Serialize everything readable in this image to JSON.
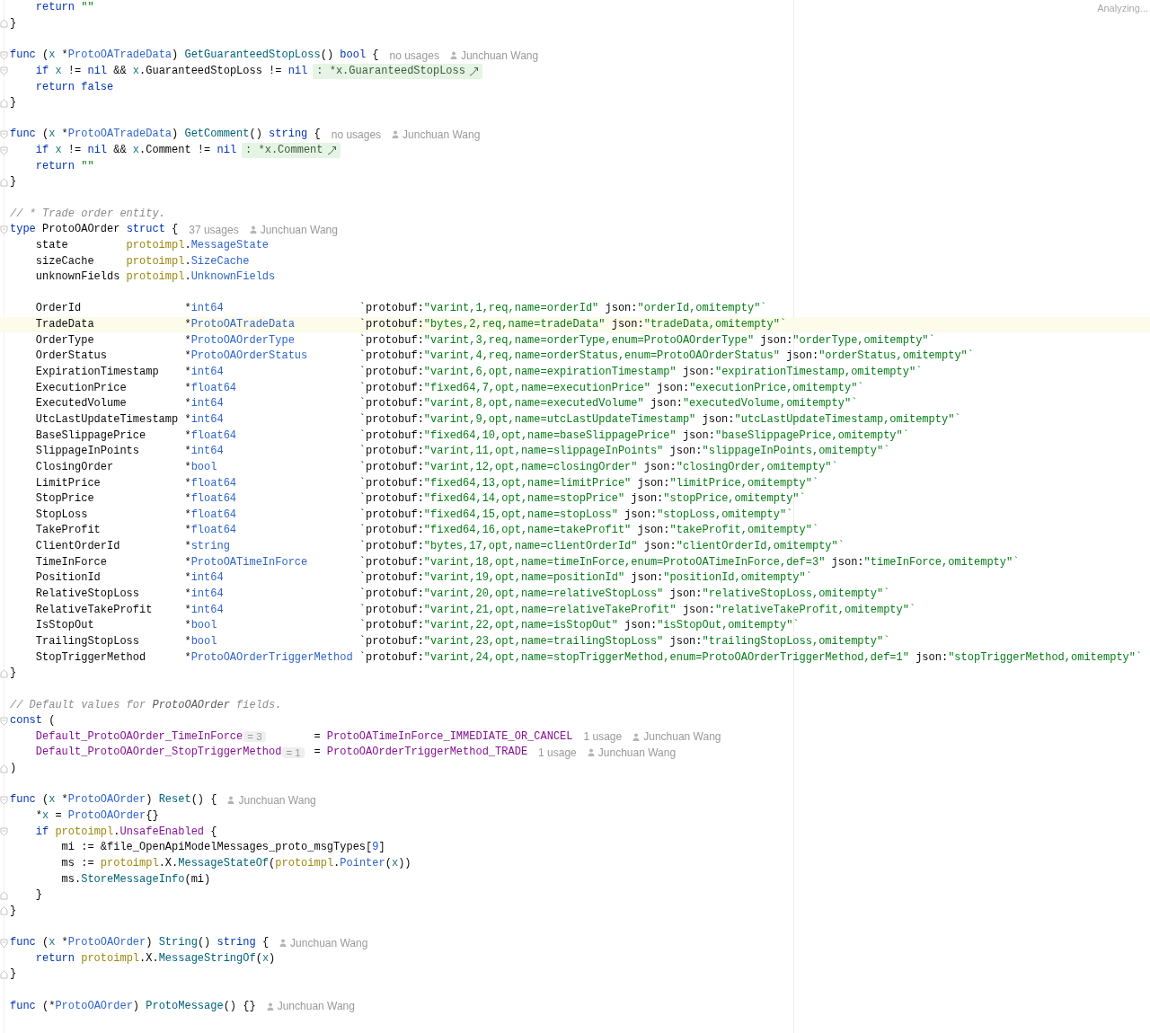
{
  "status": "Analyzing...",
  "lines": [
    {
      "kind": "code",
      "highlighted": false,
      "tokens": [
        {
          "kind": "kw",
          "text": "    return "
        },
        {
          "kind": "str",
          "text": "\"\""
        }
      ]
    },
    {
      "kind": "code",
      "highlighted": false,
      "gutter": {
        "kind": "fold_end"
      },
      "tokens": [
        {
          "kind": "plain",
          "text": "}"
        }
      ]
    },
    {
      "kind": "blank",
      "highlighted": false
    },
    {
      "kind": "code",
      "highlighted": false,
      "gutter": {
        "kind": "fold_start"
      },
      "tokens": [
        {
          "kind": "kw",
          "text": "func"
        },
        {
          "kind": "plain",
          "text": " ("
        },
        {
          "kind": "recv",
          "text": "x"
        },
        {
          "kind": "plain",
          "text": " *"
        },
        {
          "kind": "type",
          "text": "ProtoOATradeData"
        },
        {
          "kind": "plain",
          "text": ") "
        },
        {
          "kind": "fn",
          "text": "GetGuaranteedStopLoss"
        },
        {
          "kind": "plain",
          "text": "() "
        },
        {
          "kind": "kw",
          "text": "bool"
        },
        {
          "kind": "plain",
          "text": " {"
        }
      ],
      "usages": "no usages",
      "author": "Junchuan Wang"
    },
    {
      "kind": "code",
      "highlighted": false,
      "gutter": {
        "kind": "fold_start"
      },
      "tokens": [
        {
          "kind": "kw",
          "text": "    if "
        },
        {
          "kind": "recv",
          "text": "x"
        },
        {
          "kind": "plain",
          "text": " != "
        },
        {
          "kind": "kw",
          "text": "nil"
        },
        {
          "kind": "plain",
          "text": " && "
        },
        {
          "kind": "recv",
          "text": "x"
        },
        {
          "kind": "plain",
          "text": ".GuaranteedStopLoss != "
        },
        {
          "kind": "kw",
          "text": "nil"
        }
      ],
      "inlay": ": *x.GuaranteedStopLoss"
    },
    {
      "kind": "code",
      "highlighted": false,
      "tokens": [
        {
          "kind": "kw",
          "text": "    return false"
        }
      ]
    },
    {
      "kind": "code",
      "highlighted": false,
      "gutter": {
        "kind": "fold_end"
      },
      "tokens": [
        {
          "kind": "plain",
          "text": "}"
        }
      ]
    },
    {
      "kind": "blank",
      "highlighted": false
    },
    {
      "kind": "code",
      "highlighted": false,
      "gutter": {
        "kind": "fold_start"
      },
      "tokens": [
        {
          "kind": "kw",
          "text": "func"
        },
        {
          "kind": "plain",
          "text": " ("
        },
        {
          "kind": "recv",
          "text": "x"
        },
        {
          "kind": "plain",
          "text": " *"
        },
        {
          "kind": "type",
          "text": "ProtoOATradeData"
        },
        {
          "kind": "plain",
          "text": ") "
        },
        {
          "kind": "fn",
          "text": "GetComment"
        },
        {
          "kind": "plain",
          "text": "() "
        },
        {
          "kind": "kw",
          "text": "string"
        },
        {
          "kind": "plain",
          "text": " {"
        }
      ],
      "usages": "no usages",
      "author": "Junchuan Wang"
    },
    {
      "kind": "code",
      "highlighted": false,
      "gutter": {
        "kind": "fold_start"
      },
      "tokens": [
        {
          "kind": "kw",
          "text": "    if "
        },
        {
          "kind": "recv",
          "text": "x"
        },
        {
          "kind": "plain",
          "text": " != "
        },
        {
          "kind": "kw",
          "text": "nil"
        },
        {
          "kind": "plain",
          "text": " && "
        },
        {
          "kind": "recv",
          "text": "x"
        },
        {
          "kind": "plain",
          "text": ".Comment != "
        },
        {
          "kind": "kw",
          "text": "nil"
        }
      ],
      "inlay": ": *x.Comment"
    },
    {
      "kind": "code",
      "highlighted": false,
      "tokens": [
        {
          "kind": "kw",
          "text": "    return "
        },
        {
          "kind": "str",
          "text": "\"\""
        }
      ]
    },
    {
      "kind": "code",
      "highlighted": false,
      "gutter": {
        "kind": "fold_end"
      },
      "tokens": [
        {
          "kind": "plain",
          "text": "}"
        }
      ]
    },
    {
      "kind": "blank",
      "highlighted": false
    },
    {
      "kind": "code",
      "highlighted": false,
      "tokens": [
        {
          "kind": "cmt",
          "text": "// * Trade order entity."
        }
      ]
    },
    {
      "kind": "code",
      "highlighted": false,
      "gutter": {
        "kind": "fold_start"
      },
      "tokens": [
        {
          "kind": "kw",
          "text": "type"
        },
        {
          "kind": "plain",
          "text": " ProtoOAOrder "
        },
        {
          "kind": "kw",
          "text": "struct"
        },
        {
          "kind": "plain",
          "text": " {"
        }
      ],
      "usages": "37 usages",
      "author": "Junchuan Wang"
    },
    {
      "kind": "member",
      "highlighted": false,
      "name": "state",
      "type": [
        {
          "kind": "pkg",
          "text": "protoimpl"
        },
        {
          "kind": "plain",
          "text": "."
        },
        {
          "kind": "type",
          "text": "MessageState"
        }
      ]
    },
    {
      "kind": "member",
      "highlighted": false,
      "name": "sizeCache",
      "type": [
        {
          "kind": "pkg",
          "text": "protoimpl"
        },
        {
          "kind": "plain",
          "text": "."
        },
        {
          "kind": "type",
          "text": "SizeCache"
        }
      ]
    },
    {
      "kind": "member",
      "highlighted": false,
      "name": "unknownFields",
      "type": [
        {
          "kind": "pkg",
          "text": "protoimpl"
        },
        {
          "kind": "plain",
          "text": "."
        },
        {
          "kind": "type",
          "text": "UnknownFields"
        }
      ]
    },
    {
      "kind": "blank",
      "highlighted": false
    },
    {
      "kind": "field",
      "highlighted": false,
      "name": "OrderId",
      "type": [
        {
          "kind": "plain",
          "text": "*"
        },
        {
          "kind": "type",
          "text": "int64"
        }
      ],
      "tag": [
        {
          "kind": "plain",
          "text": "`protobuf:"
        },
        {
          "kind": "str",
          "text": "\"varint,1,req,name=orderId\""
        },
        {
          "kind": "plain",
          "text": " json:"
        },
        {
          "kind": "str",
          "text": "\"orderId,omitempty\"`"
        }
      ]
    },
    {
      "kind": "field",
      "highlighted": true,
      "name": "TradeData",
      "type": [
        {
          "kind": "plain",
          "text": "*"
        },
        {
          "kind": "type",
          "text": "ProtoOATradeData"
        }
      ],
      "tag": [
        {
          "kind": "plain",
          "text": "`protobuf:"
        },
        {
          "kind": "str",
          "text": "\"bytes,2,req,name=tradeData\""
        },
        {
          "kind": "plain",
          "text": " json:"
        },
        {
          "kind": "str",
          "text": "\"tradeData,omitempty\"`"
        }
      ]
    },
    {
      "kind": "field",
      "highlighted": false,
      "name": "OrderType",
      "type": [
        {
          "kind": "plain",
          "text": "*"
        },
        {
          "kind": "type",
          "text": "ProtoOAOrderType"
        }
      ],
      "tag": [
        {
          "kind": "plain",
          "text": "`protobuf:"
        },
        {
          "kind": "str",
          "text": "\"varint,3,req,name=orderType,enum=ProtoOAOrderType\""
        },
        {
          "kind": "plain",
          "text": " json:"
        },
        {
          "kind": "str",
          "text": "\"orderType,omitempty\"`"
        }
      ]
    },
    {
      "kind": "field",
      "highlighted": false,
      "name": "OrderStatus",
      "type": [
        {
          "kind": "plain",
          "text": "*"
        },
        {
          "kind": "type",
          "text": "ProtoOAOrderStatus"
        }
      ],
      "tag": [
        {
          "kind": "plain",
          "text": "`protobuf:"
        },
        {
          "kind": "str",
          "text": "\"varint,4,req,name=orderStatus,enum=ProtoOAOrderStatus\""
        },
        {
          "kind": "plain",
          "text": " json:"
        },
        {
          "kind": "str",
          "text": "\"orderStatus,omitempty\"`"
        }
      ]
    },
    {
      "kind": "field",
      "highlighted": false,
      "name": "ExpirationTimestamp",
      "type": [
        {
          "kind": "plain",
          "text": "*"
        },
        {
          "kind": "type",
          "text": "int64"
        }
      ],
      "tag": [
        {
          "kind": "plain",
          "text": "`protobuf:"
        },
        {
          "kind": "str",
          "text": "\"varint,6,opt,name=expirationTimestamp\""
        },
        {
          "kind": "plain",
          "text": " json:"
        },
        {
          "kind": "str",
          "text": "\"expirationTimestamp,omitempty\"`"
        }
      ]
    },
    {
      "kind": "field",
      "highlighted": false,
      "name": "ExecutionPrice",
      "type": [
        {
          "kind": "plain",
          "text": "*"
        },
        {
          "kind": "type",
          "text": "float64"
        }
      ],
      "tag": [
        {
          "kind": "plain",
          "text": "`protobuf:"
        },
        {
          "kind": "str",
          "text": "\"fixed64,7,opt,name=executionPrice\""
        },
        {
          "kind": "plain",
          "text": " json:"
        },
        {
          "kind": "str",
          "text": "\"executionPrice,omitempty\"`"
        }
      ]
    },
    {
      "kind": "field",
      "highlighted": false,
      "name": "ExecutedVolume",
      "type": [
        {
          "kind": "plain",
          "text": "*"
        },
        {
          "kind": "type",
          "text": "int64"
        }
      ],
      "tag": [
        {
          "kind": "plain",
          "text": "`protobuf:"
        },
        {
          "kind": "str",
          "text": "\"varint,8,opt,name=executedVolume\""
        },
        {
          "kind": "plain",
          "text": " json:"
        },
        {
          "kind": "str",
          "text": "\"executedVolume,omitempty\"`"
        }
      ]
    },
    {
      "kind": "field",
      "highlighted": false,
      "name": "UtcLastUpdateTimestamp",
      "type": [
        {
          "kind": "plain",
          "text": "*"
        },
        {
          "kind": "type",
          "text": "int64"
        }
      ],
      "tag": [
        {
          "kind": "plain",
          "text": "`protobuf:"
        },
        {
          "kind": "str",
          "text": "\"varint,9,opt,name=utcLastUpdateTimestamp\""
        },
        {
          "kind": "plain",
          "text": " json:"
        },
        {
          "kind": "str",
          "text": "\"utcLastUpdateTimestamp,omitempty\"`"
        }
      ]
    },
    {
      "kind": "field",
      "highlighted": false,
      "name": "BaseSlippagePrice",
      "type": [
        {
          "kind": "plain",
          "text": "*"
        },
        {
          "kind": "type",
          "text": "float64"
        }
      ],
      "tag": [
        {
          "kind": "plain",
          "text": "`protobuf:"
        },
        {
          "kind": "str",
          "text": "\"fixed64,10,opt,name=baseSlippagePrice\""
        },
        {
          "kind": "plain",
          "text": " json:"
        },
        {
          "kind": "str",
          "text": "\"baseSlippagePrice,omitempty\"`"
        }
      ]
    },
    {
      "kind": "field",
      "highlighted": false,
      "name": "SlippageInPoints",
      "type": [
        {
          "kind": "plain",
          "text": "*"
        },
        {
          "kind": "type",
          "text": "int64"
        }
      ],
      "tag": [
        {
          "kind": "plain",
          "text": "`protobuf:"
        },
        {
          "kind": "str",
          "text": "\"varint,11,opt,name=slippageInPoints\""
        },
        {
          "kind": "plain",
          "text": " json:"
        },
        {
          "kind": "str",
          "text": "\"slippageInPoints,omitempty\"`"
        }
      ]
    },
    {
      "kind": "field",
      "highlighted": false,
      "name": "ClosingOrder",
      "type": [
        {
          "kind": "plain",
          "text": "*"
        },
        {
          "kind": "type",
          "text": "bool"
        }
      ],
      "tag": [
        {
          "kind": "plain",
          "text": "`protobuf:"
        },
        {
          "kind": "str",
          "text": "\"varint,12,opt,name=closingOrder\""
        },
        {
          "kind": "plain",
          "text": " json:"
        },
        {
          "kind": "str",
          "text": "\"closingOrder,omitempty\"`"
        }
      ]
    },
    {
      "kind": "field",
      "highlighted": false,
      "name": "LimitPrice",
      "type": [
        {
          "kind": "plain",
          "text": "*"
        },
        {
          "kind": "type",
          "text": "float64"
        }
      ],
      "tag": [
        {
          "kind": "plain",
          "text": "`protobuf:"
        },
        {
          "kind": "str",
          "text": "\"fixed64,13,opt,name=limitPrice\""
        },
        {
          "kind": "plain",
          "text": " json:"
        },
        {
          "kind": "str",
          "text": "\"limitPrice,omitempty\"`"
        }
      ]
    },
    {
      "kind": "field",
      "highlighted": false,
      "name": "StopPrice",
      "type": [
        {
          "kind": "plain",
          "text": "*"
        },
        {
          "kind": "type",
          "text": "float64"
        }
      ],
      "tag": [
        {
          "kind": "plain",
          "text": "`protobuf:"
        },
        {
          "kind": "str",
          "text": "\"fixed64,14,opt,name=stopPrice\""
        },
        {
          "kind": "plain",
          "text": " json:"
        },
        {
          "kind": "str",
          "text": "\"stopPrice,omitempty\"`"
        }
      ]
    },
    {
      "kind": "field",
      "highlighted": false,
      "name": "StopLoss",
      "type": [
        {
          "kind": "plain",
          "text": "*"
        },
        {
          "kind": "type",
          "text": "float64"
        }
      ],
      "tag": [
        {
          "kind": "plain",
          "text": "`protobuf:"
        },
        {
          "kind": "str",
          "text": "\"fixed64,15,opt,name=stopLoss\""
        },
        {
          "kind": "plain",
          "text": " json:"
        },
        {
          "kind": "str",
          "text": "\"stopLoss,omitempty\"`"
        }
      ]
    },
    {
      "kind": "field",
      "highlighted": false,
      "name": "TakeProfit",
      "type": [
        {
          "kind": "plain",
          "text": "*"
        },
        {
          "kind": "type",
          "text": "float64"
        }
      ],
      "tag": [
        {
          "kind": "plain",
          "text": "`protobuf:"
        },
        {
          "kind": "str",
          "text": "\"fixed64,16,opt,name=takeProfit\""
        },
        {
          "kind": "plain",
          "text": " json:"
        },
        {
          "kind": "str",
          "text": "\"takeProfit,omitempty\"`"
        }
      ]
    },
    {
      "kind": "field",
      "highlighted": false,
      "name": "ClientOrderId",
      "type": [
        {
          "kind": "plain",
          "text": "*"
        },
        {
          "kind": "type",
          "text": "string"
        }
      ],
      "tag": [
        {
          "kind": "plain",
          "text": "`protobuf:"
        },
        {
          "kind": "str",
          "text": "\"bytes,17,opt,name=clientOrderId\""
        },
        {
          "kind": "plain",
          "text": " json:"
        },
        {
          "kind": "str",
          "text": "\"clientOrderId,omitempty\"`"
        }
      ]
    },
    {
      "kind": "field",
      "highlighted": false,
      "name": "TimeInForce",
      "type": [
        {
          "kind": "plain",
          "text": "*"
        },
        {
          "kind": "type",
          "text": "ProtoOATimeInForce"
        }
      ],
      "tag": [
        {
          "kind": "plain",
          "text": "`protobuf:"
        },
        {
          "kind": "str",
          "text": "\"varint,18,opt,name=timeInForce,enum=ProtoOATimeInForce,def=3\""
        },
        {
          "kind": "plain",
          "text": " json:"
        },
        {
          "kind": "str",
          "text": "\"timeInForce,omitempty\"`"
        }
      ]
    },
    {
      "kind": "field",
      "highlighted": false,
      "name": "PositionId",
      "type": [
        {
          "kind": "plain",
          "text": "*"
        },
        {
          "kind": "type",
          "text": "int64"
        }
      ],
      "tag": [
        {
          "kind": "plain",
          "text": "`protobuf:"
        },
        {
          "kind": "str",
          "text": "\"varint,19,opt,name=positionId\""
        },
        {
          "kind": "plain",
          "text": " json:"
        },
        {
          "kind": "str",
          "text": "\"positionId,omitempty\"`"
        }
      ]
    },
    {
      "kind": "field",
      "highlighted": false,
      "name": "RelativeStopLoss",
      "type": [
        {
          "kind": "plain",
          "text": "*"
        },
        {
          "kind": "type",
          "text": "int64"
        }
      ],
      "tag": [
        {
          "kind": "plain",
          "text": "`protobuf:"
        },
        {
          "kind": "str",
          "text": "\"varint,20,opt,name=relativeStopLoss\""
        },
        {
          "kind": "plain",
          "text": " json:"
        },
        {
          "kind": "str",
          "text": "\"relativeStopLoss,omitempty\"`"
        }
      ]
    },
    {
      "kind": "field",
      "highlighted": false,
      "name": "RelativeTakeProfit",
      "type": [
        {
          "kind": "plain",
          "text": "*"
        },
        {
          "kind": "type",
          "text": "int64"
        }
      ],
      "tag": [
        {
          "kind": "plain",
          "text": "`protobuf:"
        },
        {
          "kind": "str",
          "text": "\"varint,21,opt,name=relativeTakeProfit\""
        },
        {
          "kind": "plain",
          "text": " json:"
        },
        {
          "kind": "str",
          "text": "\"relativeTakeProfit,omitempty\"`"
        }
      ]
    },
    {
      "kind": "field",
      "highlighted": false,
      "name": "IsStopOut",
      "type": [
        {
          "kind": "plain",
          "text": "*"
        },
        {
          "kind": "type",
          "text": "bool"
        }
      ],
      "tag": [
        {
          "kind": "plain",
          "text": "`protobuf:"
        },
        {
          "kind": "str",
          "text": "\"varint,22,opt,name=isStopOut\""
        },
        {
          "kind": "plain",
          "text": " json:"
        },
        {
          "kind": "str",
          "text": "\"isStopOut,omitempty\"`"
        }
      ]
    },
    {
      "kind": "field",
      "highlighted": false,
      "name": "TrailingStopLoss",
      "type": [
        {
          "kind": "plain",
          "text": "*"
        },
        {
          "kind": "type",
          "text": "bool"
        }
      ],
      "tag": [
        {
          "kind": "plain",
          "text": "`protobuf:"
        },
        {
          "kind": "str",
          "text": "\"varint,23,opt,name=trailingStopLoss\""
        },
        {
          "kind": "plain",
          "text": " json:"
        },
        {
          "kind": "str",
          "text": "\"trailingStopLoss,omitempty\"`"
        }
      ]
    },
    {
      "kind": "field",
      "highlighted": false,
      "name": "StopTriggerMethod",
      "type": [
        {
          "kind": "plain",
          "text": "*"
        },
        {
          "kind": "type",
          "text": "ProtoOAOrderTriggerMethod"
        }
      ],
      "tag": [
        {
          "kind": "plain",
          "text": "`protobuf:"
        },
        {
          "kind": "str",
          "text": "\"varint,24,opt,name=stopTriggerMethod,enum=ProtoOAOrderTriggerMethod,def=1\""
        },
        {
          "kind": "plain",
          "text": " json:"
        },
        {
          "kind": "str",
          "text": "\"stopTriggerMethod,omitempty\"`"
        }
      ]
    },
    {
      "kind": "code",
      "highlighted": false,
      "gutter": {
        "kind": "fold_end"
      },
      "tokens": [
        {
          "kind": "plain",
          "text": "}"
        }
      ]
    },
    {
      "kind": "blank",
      "highlighted": false
    },
    {
      "kind": "code",
      "highlighted": false,
      "tokens": [
        {
          "kind": "cmt",
          "text": "// Default values for "
        },
        {
          "kind": "cmtref",
          "text": "ProtoOAOrder"
        },
        {
          "kind": "cmt",
          "text": " fields."
        }
      ]
    },
    {
      "kind": "code",
      "highlighted": false,
      "gutter": {
        "kind": "fold_start"
      },
      "tokens": [
        {
          "kind": "kw",
          "text": "const"
        },
        {
          "kind": "plain",
          "text": " ("
        }
      ]
    },
    {
      "kind": "const",
      "highlighted": false,
      "name": "Default_ProtoOAOrder_TimeInForce",
      "value_hint": "= 3",
      "tokens": [
        {
          "kind": "plain",
          "text": "= "
        },
        {
          "kind": "const",
          "text": "ProtoOATimeInForce_IMMEDIATE_OR_CANCEL"
        }
      ],
      "usages": "1 usage",
      "author": "Junchuan Wang"
    },
    {
      "kind": "const",
      "highlighted": false,
      "name": "Default_ProtoOAOrder_StopTriggerMethod",
      "value_hint": "= 1",
      "tokens": [
        {
          "kind": "plain",
          "text": "= "
        },
        {
          "kind": "const",
          "text": "ProtoOAOrderTriggerMethod_TRADE"
        }
      ],
      "usages": "1 usage",
      "author": "Junchuan Wang"
    },
    {
      "kind": "code",
      "highlighted": false,
      "gutter": {
        "kind": "fold_end"
      },
      "tokens": [
        {
          "kind": "plain",
          "text": ")"
        }
      ]
    },
    {
      "kind": "blank",
      "highlighted": false
    },
    {
      "kind": "code",
      "highlighted": false,
      "gutter": {
        "kind": "fold_start"
      },
      "tokens": [
        {
          "kind": "kw",
          "text": "func"
        },
        {
          "kind": "plain",
          "text": " ("
        },
        {
          "kind": "recv",
          "text": "x"
        },
        {
          "kind": "plain",
          "text": " *"
        },
        {
          "kind": "type",
          "text": "ProtoOAOrder"
        },
        {
          "kind": "plain",
          "text": ") "
        },
        {
          "kind": "fn",
          "text": "Reset"
        },
        {
          "kind": "plain",
          "text": "() {"
        }
      ],
      "author": "Junchuan Wang"
    },
    {
      "kind": "code",
      "highlighted": false,
      "tokens": [
        {
          "kind": "plain",
          "text": "    *"
        },
        {
          "kind": "recv",
          "text": "x"
        },
        {
          "kind": "plain",
          "text": " = "
        },
        {
          "kind": "type",
          "text": "ProtoOAOrder"
        },
        {
          "kind": "plain",
          "text": "{}"
        }
      ]
    },
    {
      "kind": "code",
      "highlighted": false,
      "gutter": {
        "kind": "fold_start"
      },
      "tokens": [
        {
          "kind": "kw",
          "text": "    if "
        },
        {
          "kind": "pkg",
          "text": "protoimpl"
        },
        {
          "kind": "plain",
          "text": "."
        },
        {
          "kind": "const",
          "text": "UnsafeEnabled"
        },
        {
          "kind": "plain",
          "text": " {"
        }
      ]
    },
    {
      "kind": "code",
      "highlighted": false,
      "tokens": [
        {
          "kind": "plain",
          "text": "        mi := &file_OpenApiModelMessages_proto_msgTypes["
        },
        {
          "kind": "num",
          "text": "9"
        },
        {
          "kind": "plain",
          "text": "]"
        }
      ]
    },
    {
      "kind": "code",
      "highlighted": false,
      "tokens": [
        {
          "kind": "plain",
          "text": "        ms := "
        },
        {
          "kind": "pkg",
          "text": "protoimpl"
        },
        {
          "kind": "plain",
          "text": ".X."
        },
        {
          "kind": "fn",
          "text": "MessageStateOf"
        },
        {
          "kind": "plain",
          "text": "("
        },
        {
          "kind": "pkg",
          "text": "protoimpl"
        },
        {
          "kind": "plain",
          "text": "."
        },
        {
          "kind": "type",
          "text": "Pointer"
        },
        {
          "kind": "plain",
          "text": "("
        },
        {
          "kind": "recv",
          "text": "x"
        },
        {
          "kind": "plain",
          "text": "))"
        }
      ]
    },
    {
      "kind": "code",
      "highlighted": false,
      "tokens": [
        {
          "kind": "plain",
          "text": "        ms."
        },
        {
          "kind": "fn",
          "text": "StoreMessageInfo"
        },
        {
          "kind": "plain",
          "text": "(mi)"
        }
      ]
    },
    {
      "kind": "code",
      "highlighted": false,
      "gutter": {
        "kind": "fold_end"
      },
      "tokens": [
        {
          "kind": "plain",
          "text": "    }"
        }
      ]
    },
    {
      "kind": "code",
      "highlighted": false,
      "gutter": {
        "kind": "fold_end"
      },
      "tokens": [
        {
          "kind": "plain",
          "text": "}"
        }
      ]
    },
    {
      "kind": "blank",
      "highlighted": false
    },
    {
      "kind": "code",
      "highlighted": false,
      "gutter": {
        "kind": "fold_start"
      },
      "tokens": [
        {
          "kind": "kw",
          "text": "func"
        },
        {
          "kind": "plain",
          "text": " ("
        },
        {
          "kind": "recv",
          "text": "x"
        },
        {
          "kind": "plain",
          "text": " *"
        },
        {
          "kind": "type",
          "text": "ProtoOAOrder"
        },
        {
          "kind": "plain",
          "text": ") "
        },
        {
          "kind": "fn",
          "text": "String"
        },
        {
          "kind": "plain",
          "text": "() "
        },
        {
          "kind": "kw",
          "text": "string"
        },
        {
          "kind": "plain",
          "text": " {"
        }
      ],
      "author": "Junchuan Wang"
    },
    {
      "kind": "code",
      "highlighted": false,
      "tokens": [
        {
          "kind": "kw",
          "text": "    return "
        },
        {
          "kind": "pkg",
          "text": "protoimpl"
        },
        {
          "kind": "plain",
          "text": ".X."
        },
        {
          "kind": "fn",
          "text": "MessageStringOf"
        },
        {
          "kind": "plain",
          "text": "("
        },
        {
          "kind": "recv",
          "text": "x"
        },
        {
          "kind": "plain",
          "text": ")"
        }
      ]
    },
    {
      "kind": "code",
      "highlighted": false,
      "gutter": {
        "kind": "fold_end"
      },
      "tokens": [
        {
          "kind": "plain",
          "text": "}"
        }
      ]
    },
    {
      "kind": "blank",
      "highlighted": false
    },
    {
      "kind": "code",
      "highlighted": false,
      "tokens": [
        {
          "kind": "kw",
          "text": "func"
        },
        {
          "kind": "plain",
          "text": " (*"
        },
        {
          "kind": "type",
          "text": "ProtoOAOrder"
        },
        {
          "kind": "plain",
          "text": ") "
        },
        {
          "kind": "fn",
          "text": "ProtoMessage"
        },
        {
          "kind": "plain",
          "text": "() {}"
        }
      ],
      "author": "Junchuan Wang"
    }
  ]
}
